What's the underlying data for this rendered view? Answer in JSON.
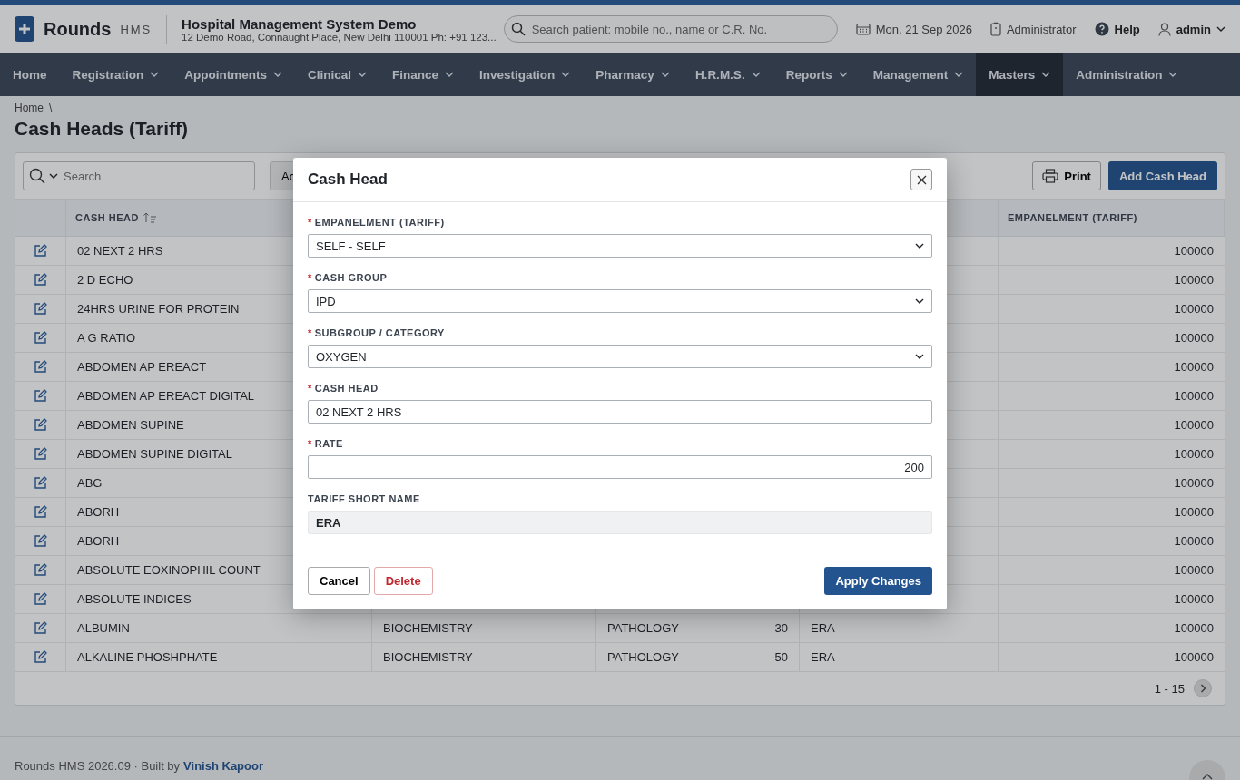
{
  "header": {
    "brand": "Rounds",
    "brand_suffix": "HMS",
    "hospital_name": "Hospital Management System Demo",
    "address": "12 Demo Road, Connaught Place, New Delhi 110001 Ph: +91 123...",
    "search": {
      "placeholder": "Search patient: mobile no., name or C.R. No."
    },
    "date": "Mon, 21 Sep 2026",
    "role": "Administrator",
    "help": "Help",
    "user": "admin"
  },
  "nav": [
    {
      "label": "Home",
      "has_menu": false,
      "selected": false
    },
    {
      "label": "Registration",
      "has_menu": true,
      "selected": false
    },
    {
      "label": "Appointments",
      "has_menu": true,
      "selected": false
    },
    {
      "label": "Clinical",
      "has_menu": true,
      "selected": false
    },
    {
      "label": "Finance",
      "has_menu": true,
      "selected": false
    },
    {
      "label": "Investigation",
      "has_menu": true,
      "selected": false
    },
    {
      "label": "Pharmacy",
      "has_menu": true,
      "selected": false
    },
    {
      "label": "H.R.M.S.",
      "has_menu": true,
      "selected": false
    },
    {
      "label": "Reports",
      "has_menu": true,
      "selected": false
    },
    {
      "label": "Management",
      "has_menu": true,
      "selected": false
    },
    {
      "label": "Masters",
      "has_menu": true,
      "selected": true
    },
    {
      "label": "Administration",
      "has_menu": true,
      "selected": false
    }
  ],
  "breadcrumb": {
    "items": [
      "Home"
    ],
    "separator": "\\"
  },
  "page_title": "Cash Heads (Tariff)",
  "toolbar": {
    "search": {
      "placeholder": "Search"
    },
    "actions_button": "Ac",
    "print_button": "Print",
    "add_button": "Add Cash Head"
  },
  "table": {
    "columns": {
      "cash_head": "CASH HEAD",
      "empanelment": "EMPANELMENT (TARIFF)"
    },
    "rows": [
      {
        "cash_head": "02 NEXT 2 HRS",
        "empanelment": "100000"
      },
      {
        "cash_head": "2 D ECHO",
        "empanelment": "100000"
      },
      {
        "cash_head": "24HRS URINE FOR PROTEIN",
        "empanelment": "100000"
      },
      {
        "cash_head": "A G RATIO",
        "empanelment": "100000"
      },
      {
        "cash_head": "ABDOMEN AP EREACT",
        "empanelment": "100000"
      },
      {
        "cash_head": "ABDOMEN AP EREACT DIGITAL",
        "empanelment": "100000"
      },
      {
        "cash_head": "ABDOMEN SUPINE",
        "empanelment": "100000"
      },
      {
        "cash_head": "ABDOMEN SUPINE DIGITAL",
        "empanelment": "100000"
      },
      {
        "cash_head": "ABG",
        "empanelment": "100000"
      },
      {
        "cash_head": "ABORH",
        "empanelment": "100000"
      },
      {
        "cash_head": "ABORH",
        "empanelment": "100000"
      },
      {
        "cash_head": "ABSOLUTE EOXINOPHIL COUNT",
        "empanelment": "100000"
      },
      {
        "cash_head": "ABSOLUTE INDICES",
        "empanelment": "100000"
      },
      {
        "cash_head": "ALBUMIN",
        "column_2": "BIOCHEMISTRY",
        "column_3": "PATHOLOGY",
        "column_4": "30",
        "column_5": "ERA",
        "empanelment": "100000"
      },
      {
        "cash_head": "ALKALINE PHOSHPHATE",
        "column_2": "BIOCHEMISTRY",
        "column_3": "PATHOLOGY",
        "column_4": "50",
        "column_5": "ERA",
        "empanelment": "100000"
      }
    ],
    "pagination": "1 - 15"
  },
  "footer": {
    "text": "Rounds HMS 2026.09 · Built by",
    "link": "Vinish Kapoor"
  },
  "dialog": {
    "title": "Cash Head",
    "fields": [
      {
        "label": "EMPANELMENT (TARIFF)",
        "required_mark": "*",
        "kind": "select",
        "value": "SELF - SELF"
      },
      {
        "label": "CASH GROUP",
        "required_mark": "*",
        "kind": "select",
        "value": "IPD"
      },
      {
        "label": "SUBGROUP / CATEGORY",
        "required_mark": "*",
        "kind": "select",
        "value": "OXYGEN"
      },
      {
        "label": "CASH HEAD",
        "required_mark": "*",
        "kind": "text",
        "value": "02 NEXT 2 HRS"
      },
      {
        "label": "RATE",
        "required_mark": "*",
        "kind": "number",
        "value": "200"
      },
      {
        "label": "TARIFF SHORT NAME",
        "kind": "readonly",
        "value": "ERA"
      }
    ],
    "buttons": {
      "cancel": "Cancel",
      "delete": "Delete",
      "apply": "Apply Changes"
    }
  }
}
